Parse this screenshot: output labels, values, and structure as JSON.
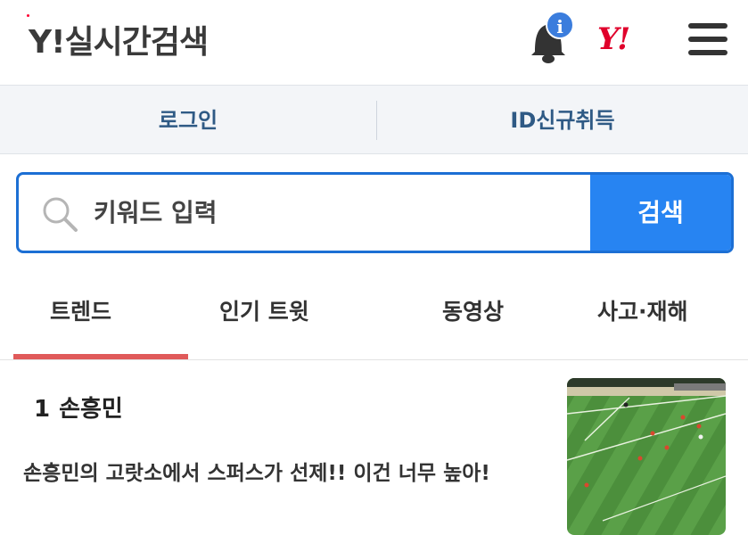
{
  "header": {
    "title": "Y!실시간검색",
    "notification_badge": "i",
    "logo": "Y!"
  },
  "auth": {
    "login": "로그인",
    "register": "ID신규취득"
  },
  "search": {
    "placeholder": "키워드 입력",
    "button": "검색"
  },
  "tabs": [
    {
      "label": "트렌드",
      "active": true
    },
    {
      "label": "인기 트윗",
      "active": false
    },
    {
      "label": "동영상",
      "active": false
    },
    {
      "label": "사고·재해",
      "active": false
    }
  ],
  "article": {
    "rank": "1",
    "keyword": "손흥민",
    "headline": "손흥민의 고랏소에서 스퍼스가 선제!! 이건 너무 높아!"
  },
  "colors": {
    "accent": "#2784f2",
    "brand_red": "#e0002b",
    "tab_underline": "#e05a5a"
  }
}
